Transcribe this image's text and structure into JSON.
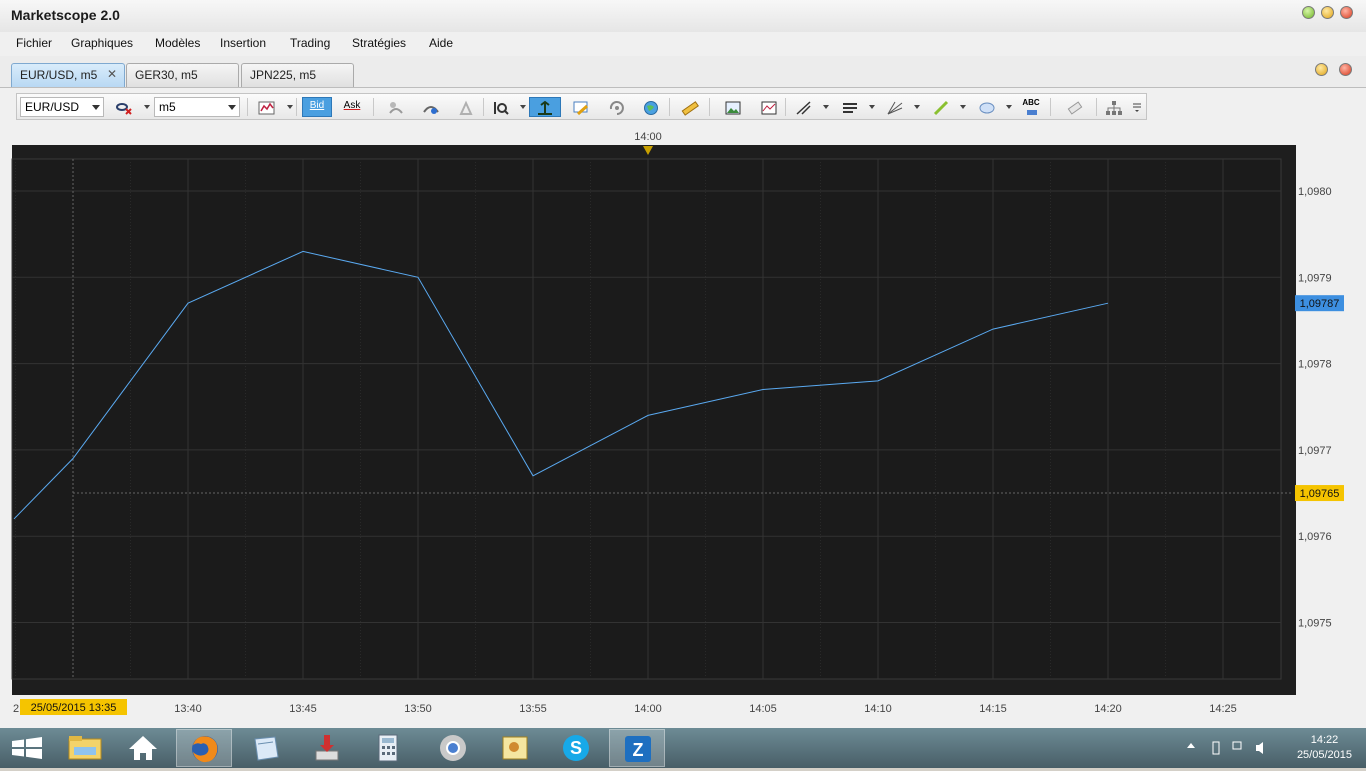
{
  "window": {
    "title": "Marketscope 2.0"
  },
  "menu": [
    "Fichier",
    "Graphiques",
    "Modèles",
    "Insertion",
    "Trading",
    "Stratégies",
    "Aide"
  ],
  "tabs": [
    {
      "label": "EUR/USD, m5",
      "active": true
    },
    {
      "label": "GER30, m5",
      "active": false
    },
    {
      "label": "JPN225, m5",
      "active": false
    }
  ],
  "toolbar": {
    "instrument": "EUR/USD",
    "timeframe": "m5",
    "bid_label": "Bid",
    "ask_label": "Ask",
    "abc_label": "ABC"
  },
  "chart": {
    "top_time_label": "14:00",
    "cursor_date_label": "25/05/2015 13:35",
    "cursor_date_prefix": "2",
    "current_price_label": "1,09787",
    "crosshair_price_label": "1,09765",
    "line_color": "#5aa9f0",
    "current_price_color": "#3d8fe0",
    "crosshair_color": "#f5c400"
  },
  "chart_data": {
    "type": "line",
    "series": [
      {
        "values": [
          {
            "x": "13:30",
            "y": 1.09762
          },
          {
            "x": "13:35",
            "y": 1.09769
          },
          {
            "x": "13:40",
            "y": 1.09787
          },
          {
            "x": "13:45",
            "y": 1.09793
          },
          {
            "x": "13:50",
            "y": 1.0979
          },
          {
            "x": "13:55",
            "y": 1.09767
          },
          {
            "x": "14:00",
            "y": 1.09774
          },
          {
            "x": "14:05",
            "y": 1.09777
          },
          {
            "x": "14:10",
            "y": 1.09778
          },
          {
            "x": "14:15",
            "y": 1.09784
          },
          {
            "x": "14:20",
            "y": 1.09787
          }
        ]
      }
    ],
    "x_ticks": [
      "13:40",
      "13:45",
      "13:50",
      "13:55",
      "14:00",
      "14:05",
      "14:10",
      "14:15",
      "14:20",
      "14:25"
    ],
    "y_ticks": [
      {
        "value": 1.0975,
        "label": "1,0975"
      },
      {
        "value": 1.0976,
        "label": "1,0976"
      },
      {
        "value": 1.0977,
        "label": "1,0977"
      },
      {
        "value": 1.0978,
        "label": "1,0978"
      },
      {
        "value": 1.0979,
        "label": "1,0979"
      },
      {
        "value": 1.098,
        "label": "1,0980"
      }
    ],
    "grid": true,
    "background": "#1e1e1e"
  },
  "taskbar": {
    "apps": [
      "windows-start",
      "file-explorer",
      "home",
      "firefox",
      "notes",
      "installer",
      "calculator",
      "chrome",
      "photo-viewer",
      "skype",
      "marketscope"
    ],
    "time": "14:22",
    "date": "25/05/2015"
  }
}
